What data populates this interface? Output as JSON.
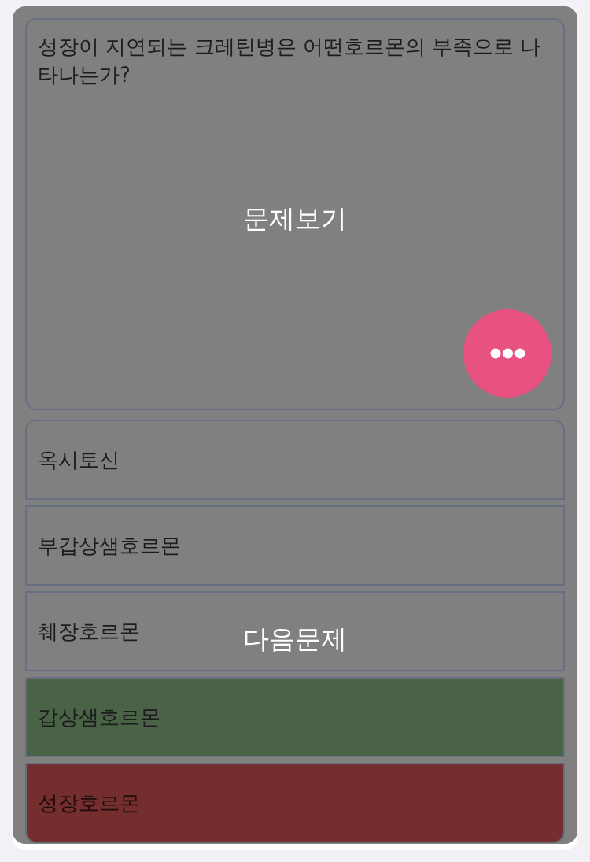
{
  "question": {
    "text": "성장이 지연되는 크레틴병은 어떤호르몬의 부족으로 나타나는가?",
    "overlay_label": "문제보기"
  },
  "options": [
    {
      "label": "옥시토신",
      "selected": false,
      "correct": false
    },
    {
      "label": "부갑상샘호르몬",
      "selected": false,
      "correct": false
    },
    {
      "label": "췌장호르몬",
      "selected": false,
      "correct": false
    },
    {
      "label": "갑상샘호르몬",
      "selected": false,
      "correct": true
    },
    {
      "label": "성장호르몬",
      "selected": true,
      "correct": false
    }
  ],
  "options_overlay_label": "다음문제"
}
